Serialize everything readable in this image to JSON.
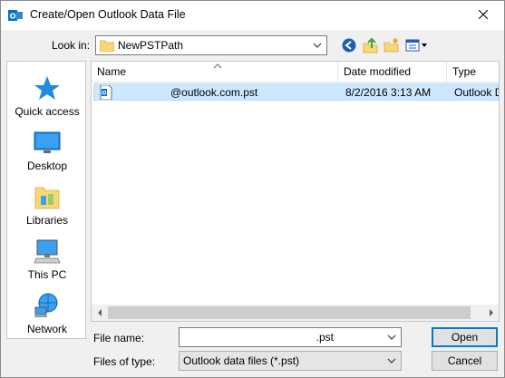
{
  "window": {
    "title": "Create/Open Outlook Data File"
  },
  "look_in": {
    "label": "Look in:",
    "value": "NewPSTPath"
  },
  "toolbar": {
    "icons": [
      "back-icon",
      "up-folder-icon",
      "new-folder-icon",
      "view-menu-icon"
    ]
  },
  "places": [
    {
      "label": "Quick access",
      "icon": "star-icon"
    },
    {
      "label": "Desktop",
      "icon": "desktop-icon"
    },
    {
      "label": "Libraries",
      "icon": "libraries-icon"
    },
    {
      "label": "This PC",
      "icon": "computer-icon"
    },
    {
      "label": "Network",
      "icon": "network-icon"
    }
  ],
  "file_list": {
    "columns": [
      "Name",
      "Date modified",
      "Type"
    ],
    "rows": [
      {
        "name": "@outlook.com.pst",
        "date": "8/2/2016 3:13 AM",
        "type": "Outlook D"
      }
    ]
  },
  "file_name": {
    "label": "File name:",
    "value": ".pst"
  },
  "file_type": {
    "label": "Files of type:",
    "value": "Outlook data files (*.pst)"
  },
  "buttons": {
    "open": "Open",
    "cancel": "Cancel"
  },
  "colors": {
    "selection": "#cce8ff",
    "accent": "#0078d7",
    "outlook_blue": "#0072c6"
  }
}
